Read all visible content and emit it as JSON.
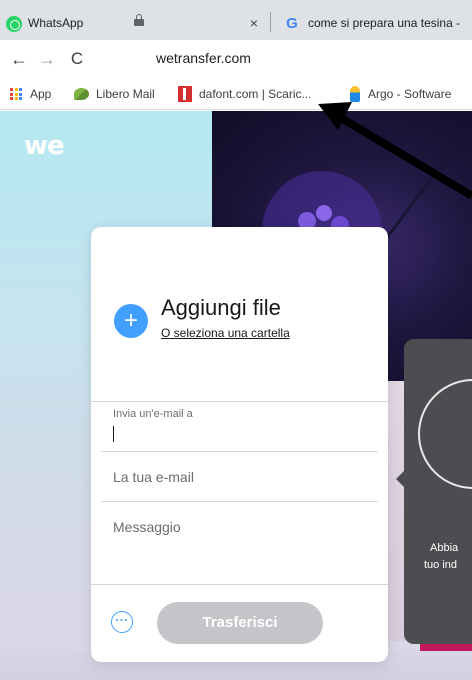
{
  "browser": {
    "tabs": [
      {
        "title": "WhatsApp",
        "icon": "whatsapp-icon"
      },
      {
        "title": "come si prepara una tesina -",
        "icon": "google-icon"
      }
    ],
    "tab_close_glyph": "×",
    "url": "wetransfer.com",
    "bookmarks": [
      {
        "label": "App",
        "icon": "apps-grid-icon"
      },
      {
        "label": "Libero Mail",
        "icon": "libero-icon"
      },
      {
        "label": "dafont.com | Scaric...",
        "icon": "dafont-icon"
      },
      {
        "label": "Argo - Software",
        "icon": "argo-icon"
      }
    ]
  },
  "page": {
    "logo": "we",
    "card": {
      "add_glyph": "+",
      "add_title": "Aggiungi file",
      "add_subtitle": "O seleziona una cartella",
      "email_to_label": "Invia un'e-mail a",
      "your_email_placeholder": "La tua e-mail",
      "message_placeholder": "Messaggio",
      "more_options_glyph": "···",
      "transfer_label": "Trasferisci"
    },
    "popover": {
      "line1": "Abbia",
      "line2": "tuo ind"
    }
  },
  "colors": {
    "accent_blue": "#409fff",
    "disabled_button": "#c3c5c8",
    "popover_bg": "#4c4d50",
    "page_bg_top": "#b5e9f3"
  }
}
